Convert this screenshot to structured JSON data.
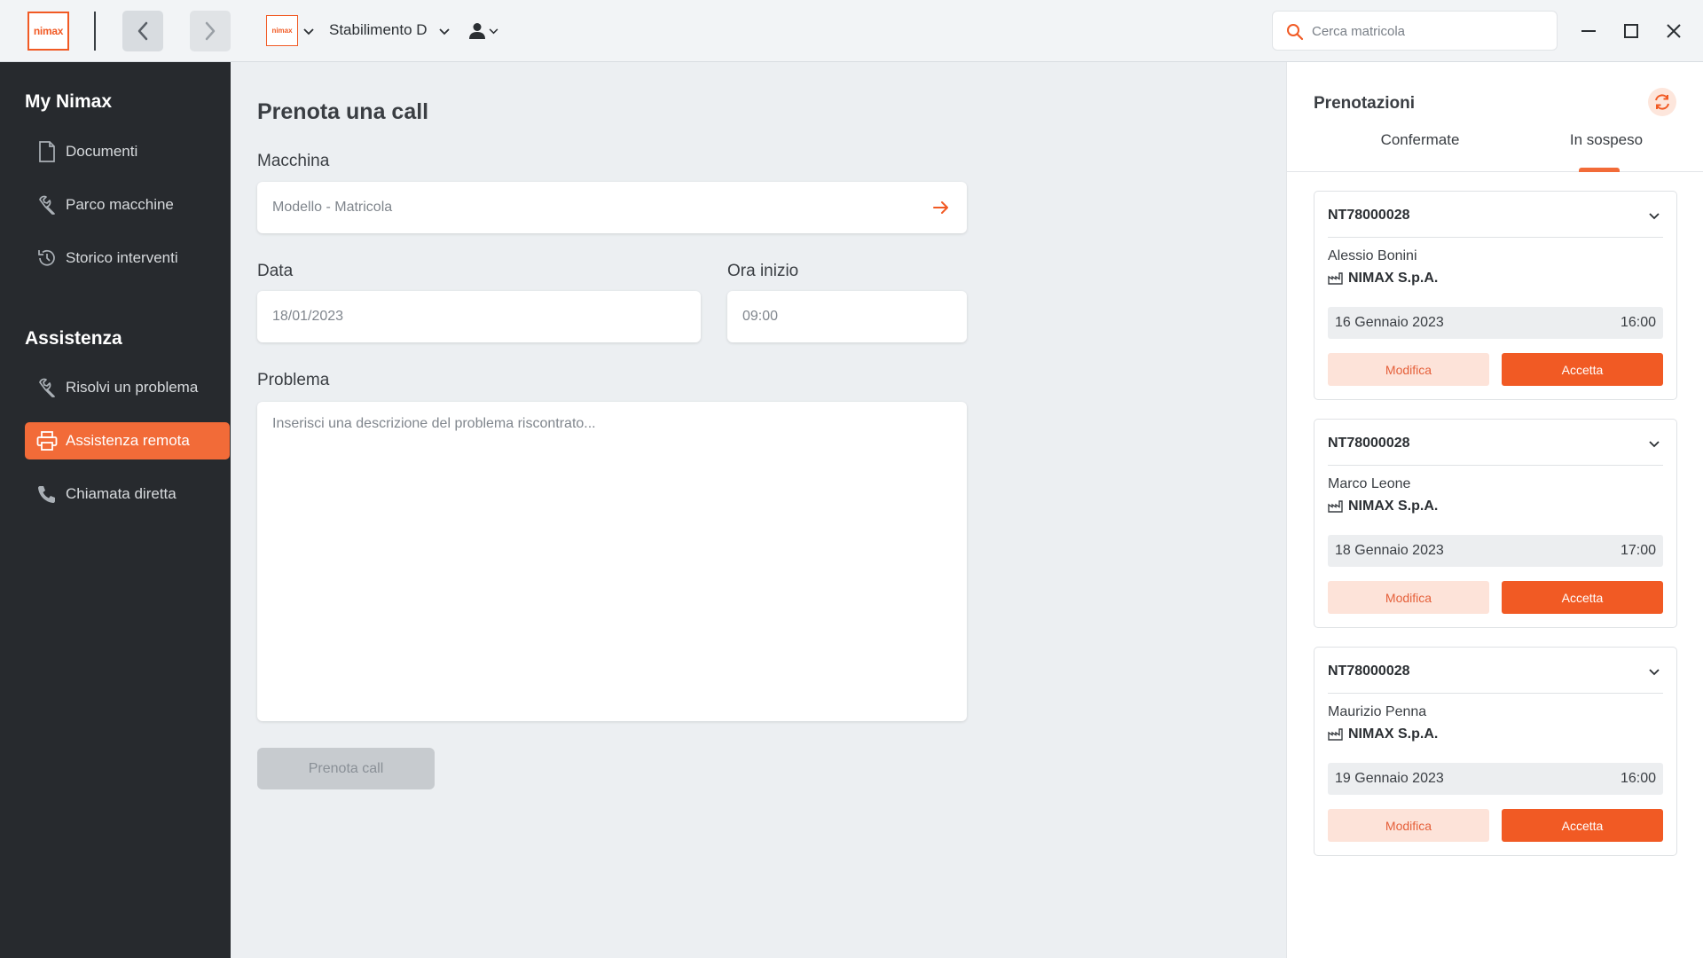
{
  "header": {
    "logo_text": "nimax",
    "plant_logo_text": "nimax",
    "plant_name": "Stabilimento D",
    "search_placeholder": "Cerca matricola",
    "brand_color": "#f15a24"
  },
  "sidebar": {
    "section1_title": "My Nimax",
    "section1_items": [
      {
        "label": "Documenti",
        "icon": "document-icon"
      },
      {
        "label": "Parco macchine",
        "icon": "wrench-icon"
      },
      {
        "label": "Storico interventi",
        "icon": "history-icon"
      }
    ],
    "section2_title": "Assistenza",
    "section2_items": [
      {
        "label": "Risolvi un problema",
        "icon": "wrench-icon"
      },
      {
        "label": "Assistenza remota",
        "icon": "printer-icon",
        "active": true
      },
      {
        "label": "Chiamata diretta",
        "icon": "phone-icon"
      }
    ]
  },
  "form": {
    "title": "Prenota una call",
    "machine_label": "Macchina",
    "machine_placeholder": "Modello - Matricola",
    "date_label": "Data",
    "date_placeholder": "18/01/2023",
    "time_label": "Ora inizio",
    "time_placeholder": "09:00",
    "problem_label": "Problema",
    "problem_placeholder": "Inserisci una descrizione del problema riscontrato...",
    "submit_label": "Prenota call"
  },
  "bookings": {
    "title": "Prenotazioni",
    "tabs": [
      "Confermate",
      "In sospeso"
    ],
    "active_tab": "In sospeso",
    "cards": [
      {
        "code": "NT78000028",
        "person": "Alessio Bonini",
        "company": "NIMAX S.p.A.",
        "date": "16 Gennaio 2023",
        "time": "16:00",
        "edit_label": "Modifica",
        "accept_label": "Accetta"
      },
      {
        "code": "NT78000028",
        "person": "Marco Leone",
        "company": "NIMAX S.p.A.",
        "date": "18 Gennaio 2023",
        "time": "17:00",
        "edit_label": "Modifica",
        "accept_label": "Accetta"
      },
      {
        "code": "NT78000028",
        "person": "Maurizio Penna",
        "company": "NIMAX S.p.A.",
        "date": "19 Gennaio 2023",
        "time": "16:00",
        "edit_label": "Modifica",
        "accept_label": "Accetta"
      }
    ]
  }
}
